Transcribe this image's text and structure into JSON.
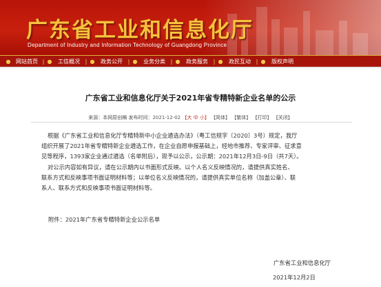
{
  "header": {
    "title_cn": "广东省工业和信息化厅",
    "title_en": "Department of Industry and Information Technology of Guangdong Province"
  },
  "nav": {
    "items": [
      "网站首页",
      "工信概况",
      "政务公开",
      "业务分类",
      "政务服务",
      "政民互动",
      "版权声明"
    ]
  },
  "article": {
    "title": "广东省工业和信息化厅关于2021年省专精特新企业名单的公示",
    "meta": {
      "source_label": "来源：",
      "source": "本网原创稿",
      "date_label": "发布时间：",
      "date": "2021-12-02",
      "font_size_label": "【大 中 小】",
      "simplified": "【简体】",
      "traditional": "【繁体】",
      "print": "【打印】",
      "close": "【关闭】"
    },
    "p1_lines": [
      "根据《广东省工业和信息化厅专精特新中小企业遴选办法》（粤工信规字〔2020〕3号）规定，我厅",
      "组织开展了2021年省专精特新企业遴选工作，在企业自愿申报基础上，经地市推荐、专家评审、征求意",
      "见等程序，1393家企业通过遴选（名单附后），现予以公示，公示期：2021年12月3日-9日（共7天）。"
    ],
    "p2_lines": [
      "对公示内容如有异议，请在公示期内以书面形式反映。以个人名义反映情况的，请提供真实姓名、",
      "联系方式和反映事项书面证明材料等；以单位名义反映情况的，请提供真实单位名称（加盖公章）、联",
      "系人、联系方式和反映事项书面证明材料等。"
    ],
    "attachment": "附件：2021年广东省专精特新企业公示名单",
    "signature_org": "广东省工业和信息化厅",
    "signature_date": "2021年12月2日"
  }
}
